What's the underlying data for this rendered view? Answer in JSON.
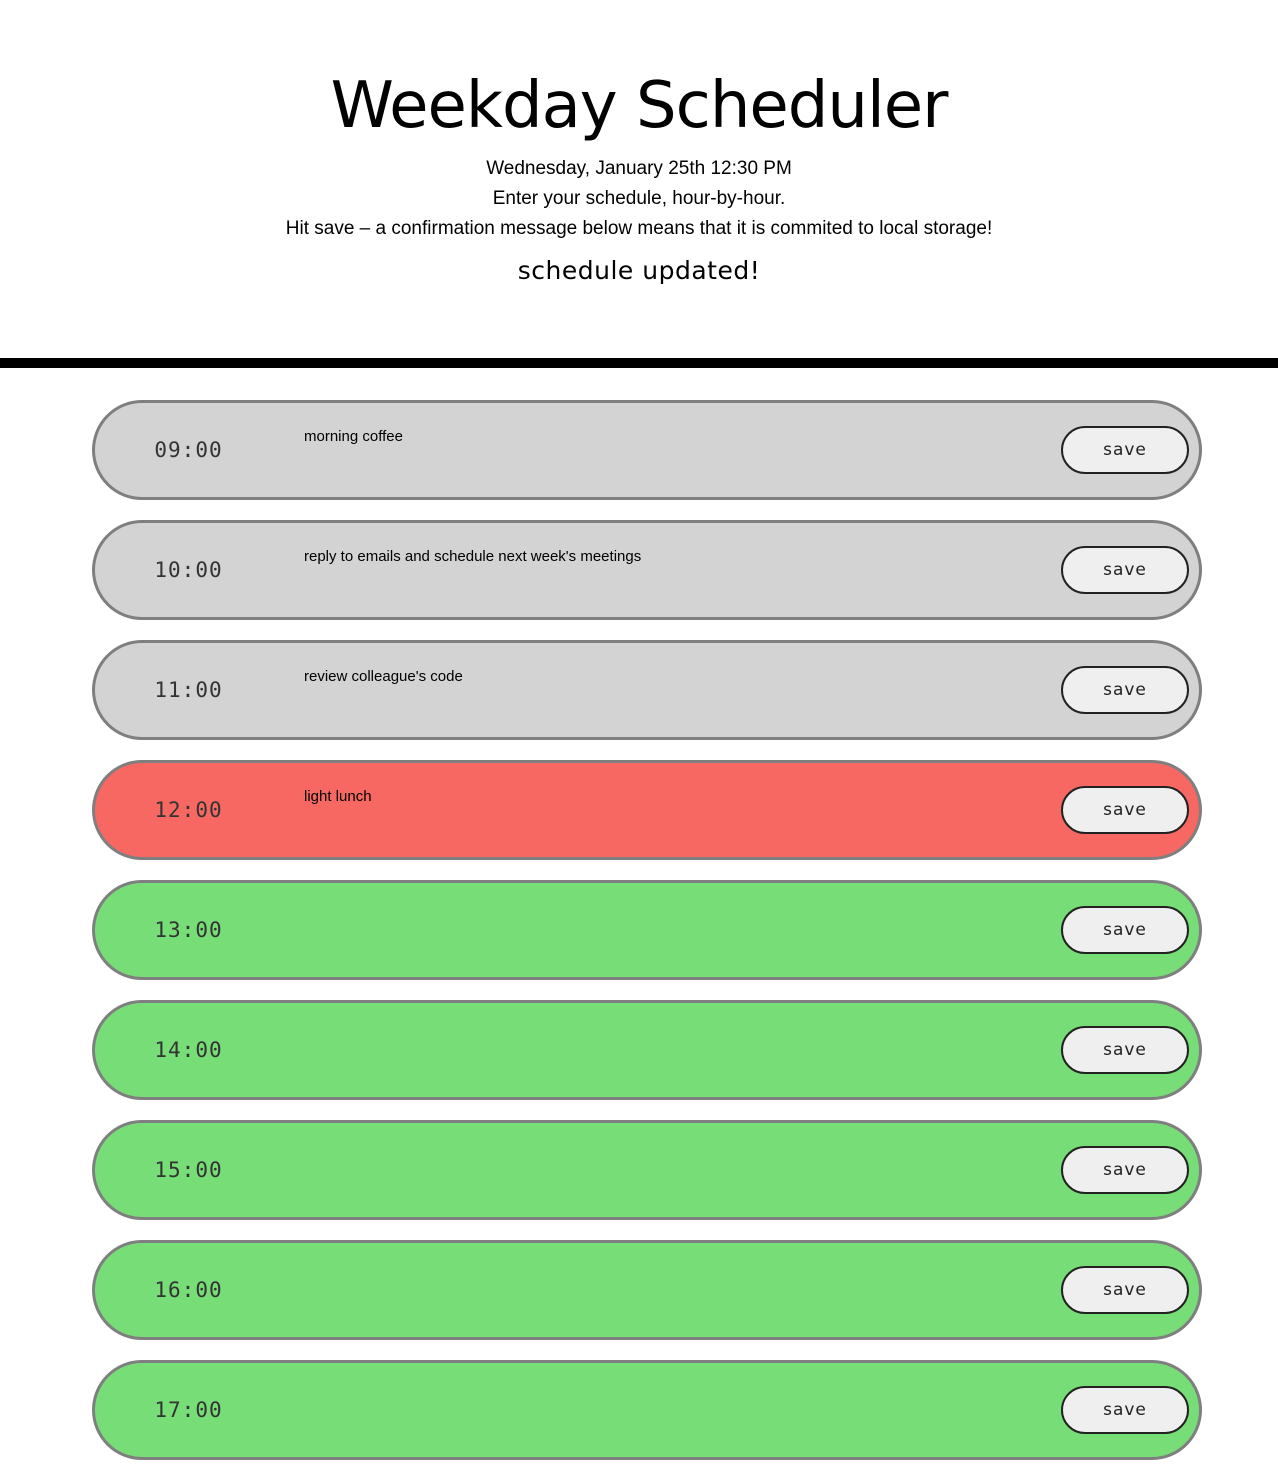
{
  "header": {
    "title": "Weekday Scheduler",
    "current_date": "Wednesday, January 25th 12:30 PM",
    "instruction_1": "Enter your schedule, hour-by-hour.",
    "instruction_2": "Hit save – a confirmation message below means that it is commited to local storage!",
    "status_message": "schedule updated!"
  },
  "colors": {
    "past": "#d3d3d3",
    "present": "#f76862",
    "future": "#77dd77",
    "border": "#7f7f7f",
    "divider": "#000000"
  },
  "blocks": [
    {
      "hour": "09:00",
      "task": "morning coffee",
      "state": "past",
      "save_label": "save"
    },
    {
      "hour": "10:00",
      "task": "reply to emails and schedule next week's meetings",
      "state": "past",
      "save_label": "save"
    },
    {
      "hour": "11:00",
      "task": "review colleague's code",
      "state": "past",
      "save_label": "save"
    },
    {
      "hour": "12:00",
      "task": "light lunch",
      "state": "present",
      "save_label": "save"
    },
    {
      "hour": "13:00",
      "task": "",
      "state": "future",
      "save_label": "save"
    },
    {
      "hour": "14:00",
      "task": "",
      "state": "future",
      "save_label": "save"
    },
    {
      "hour": "15:00",
      "task": "",
      "state": "future",
      "save_label": "save"
    },
    {
      "hour": "16:00",
      "task": "",
      "state": "future",
      "save_label": "save"
    },
    {
      "hour": "17:00",
      "task": "",
      "state": "future",
      "save_label": "save"
    }
  ]
}
